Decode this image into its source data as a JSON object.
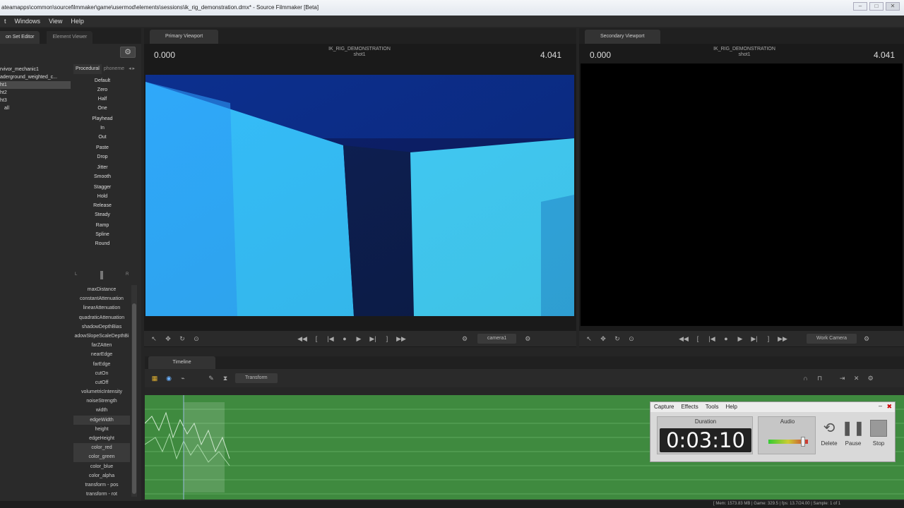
{
  "titlebar": {
    "title": "ateamapps\\common\\sourcefilmmaker\\game\\usermod\\elements\\sessions\\ik_rig_demonstration.dmx* - Source Filmmaker [Beta]"
  },
  "menu": [
    "t",
    "Windows",
    "View",
    "Help"
  ],
  "left": {
    "tabs": [
      "on Set Editor",
      "Element Viewer"
    ],
    "animsets": [
      "rvivor_mechanic1",
      "aderground_weighted_c...",
      "ht1",
      "ht2",
      "ht3",
      "all"
    ],
    "proc_tabs": [
      "Procedural",
      "phoneme"
    ],
    "proc_buttons": [
      [
        "Default",
        "Zero",
        "Half",
        "One"
      ],
      [
        "Playhead",
        "In",
        "Out"
      ],
      [
        "Paste",
        "Drop"
      ],
      [
        "Jitter",
        "Smooth"
      ],
      [
        "Stagger",
        "Hold",
        "Release",
        "Steady"
      ],
      [
        "Ramp",
        "Spline",
        "Round"
      ]
    ],
    "slider_left": "L",
    "slider_right": "R",
    "attributes": [
      "maxDistance",
      "constantAttenuation",
      "linearAttenuation",
      "quadraticAttenuation",
      "shadowDepthBias",
      "adowSlopeScaleDepthBi",
      "farZAtten",
      "nearEdge",
      "farEdge",
      "cutOn",
      "cutOff",
      "volumetricIntensity",
      "noiseStrength",
      "width",
      "edgeWidth",
      "height",
      "edgeHeight",
      "color_red",
      "color_green",
      "color_blue",
      "color_alpha",
      "transform - pos",
      "transform - rot"
    ]
  },
  "primary": {
    "tab": "Primary Viewport",
    "time_left": "0.000",
    "time_right": "4.041",
    "name": "IK_RIG_DEMONSTRATION",
    "shot": "shot1",
    "camera": "camera1"
  },
  "secondary": {
    "tab": "Secondary Viewport",
    "time_left": "0.000",
    "time_right": "4.041",
    "name": "IK_RIG_DEMONSTRATION",
    "shot": "shot1",
    "camera": "Work Camera"
  },
  "timeline": {
    "tab": "Timeline",
    "transform": "Transform"
  },
  "capture": {
    "menu": [
      "Capture",
      "Effects",
      "Tools",
      "Help"
    ],
    "duration_label": "Duration",
    "duration": "0:03:10",
    "audio_label": "Audio",
    "buttons": [
      "Delete",
      "Pause",
      "Stop"
    ]
  },
  "status": {
    "text": "[ Mem: 1573.83 MB | Game: 329.5 | fps: 13.7/24.00 | Sample: 1 of 1"
  }
}
